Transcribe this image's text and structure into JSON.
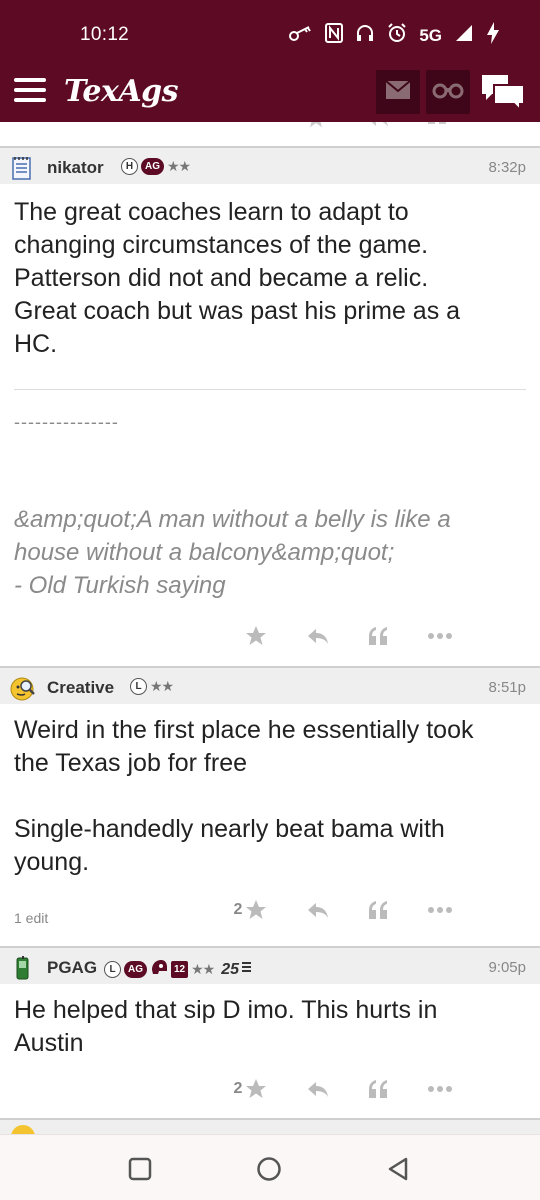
{
  "status_bar": {
    "time": "10:12",
    "network": "5G"
  },
  "app_bar": {
    "logo": "TexAgs",
    "icons": [
      "menu-icon",
      "mail-icon",
      "binoculars-icon",
      "chat-icon"
    ]
  },
  "posts": [
    {
      "username": "nikator",
      "badges": [
        "H",
        "AG"
      ],
      "stars": "★★",
      "time": "8:32p",
      "body": [
        "The great coaches learn to adapt to",
        "changing circumstances of the game.",
        "Patterson did not and became a relic.",
        "Great coach but was past his prime as a",
        "HC."
      ],
      "signature_dash": "---------------",
      "signature": [
        "&amp;quot;A man without a belly is like a",
        "house without a balcony&amp;quot;",
        "- Old Turkish saying"
      ]
    },
    {
      "username": "Creative",
      "badges": [
        "L"
      ],
      "stars": "★★",
      "time": "8:51p",
      "body": [
        "Weird in the first place he essentially took",
        "the Texas job for free",
        "",
        "Single-handedly nearly beat bama with",
        "young."
      ],
      "edit_note": "1 edit",
      "star_count": "2"
    },
    {
      "username": "PGAG",
      "badges": [
        "L",
        "AG",
        "12"
      ],
      "stars": "★★",
      "rank_label": "25",
      "time": "9:05p",
      "body": [
        "He helped that sip D imo. This hurts in",
        "Austin"
      ],
      "star_count": "2"
    }
  ],
  "colors": {
    "maroon": "#5d0b24",
    "maroon_dark": "#3e0618",
    "header_gray": "#efefef",
    "sig_gray": "#8a8a8a"
  }
}
